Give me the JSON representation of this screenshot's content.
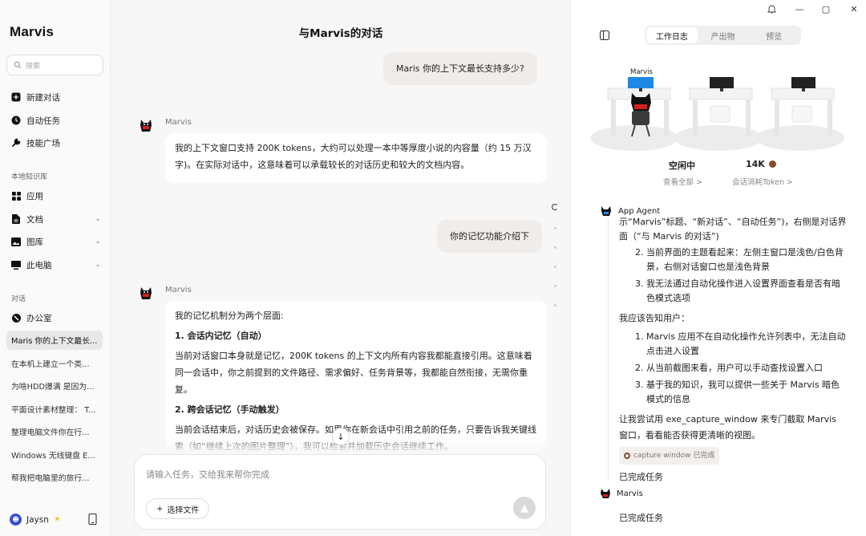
{
  "sidebar": {
    "logo": "Marvis",
    "search_placeholder": "搜索",
    "nav": [
      {
        "label": "新建对话",
        "icon": "plus-square-icon"
      },
      {
        "label": "自动任务",
        "icon": "clock-icon"
      },
      {
        "label": "技能广场",
        "icon": "wrench-icon"
      }
    ],
    "kb_label": "本地知识库",
    "kb": [
      {
        "label": "应用",
        "icon": "grid-icon"
      },
      {
        "label": "文档",
        "icon": "document-icon"
      },
      {
        "label": "图库",
        "icon": "image-icon"
      },
      {
        "label": "此电脑",
        "icon": "monitor-icon"
      }
    ],
    "conv_label": "对话",
    "office": "办公室",
    "conversations": [
      "Maris 你的上下文最长...",
      "在本机上建立一个类...",
      "为啥HDD爆满 是因为...",
      "平面设计素材整理： T...",
      "整理电脑文件你在行...",
      "Windows 无线键盘 E...",
      "帮我把电脑里的旅行..."
    ],
    "user": "Jaysn"
  },
  "chat": {
    "title": "与Marvis的对话",
    "user_msg_1": "Maris  你的上下文最长支持多少?",
    "agent_name": "Marvis",
    "agent_msg_1": "我的上下文窗口支持 200K tokens，大约可以处理一本中等厚度小说的内容量（约 15 万汉字)。在实际对话中，这意味着可以承载较长的对话历史和较大的文档内容。",
    "user_msg_2": "你的记忆功能介绍下",
    "agent_msg_2": {
      "p1": "我的记忆机制分为两个层面:",
      "h1": "1. 会话内记忆（自动）",
      "p2": "当前对话窗口本身就是记忆，200K tokens 的上下文内所有内容我都能直接引用。这意味着同一会话中，你之前提到的文件路径、需求偏好、任务背景等，我都能自然衔接，无需你重复。",
      "h2": "2. 跨会话记忆（手动触发）",
      "p3": "当前会话结束后，对话历史会被保存。如果你在新会话中引用之前的任务，只要告诉我关键线索（如“继续上次的图片整理”），我可以检索并加载历史会话继续工作。"
    },
    "composer_placeholder": "请输入任务，交给我来帮你完成",
    "file_button": "选择文件"
  },
  "panel": {
    "tabs": [
      "工作日志",
      "产出物",
      "预览"
    ],
    "active_tab": "工作日志",
    "scene_label": "Marvis",
    "status": "空闲中",
    "status_link": "查看全部 >",
    "tokens": "14K",
    "tokens_link": "会话消耗Token >",
    "log_agent": "App Agent",
    "log_text_0": "示“Marvis”标题、“新对话”、“自动任务”)，右侧是对话界面（“与 Marvis 的对话”)",
    "log_items_a": [
      "当前界面的主题看起来：左侧主窗口是浅色/白色背景，右侧对话窗口也是浅色背景",
      "我无法通过自动化操作进入设置界面查看是否有暗色模式选项"
    ],
    "log_text_1": "我应该告知用户：",
    "log_items_b": [
      "Marvis 应用不在自动化操作允许列表中，无法自动点击进入设置",
      "从当前截图来看，用户可以手动查找设置入口",
      "基于我的知识，我可以提供一些关于 Marvis 暗色模式的信息"
    ],
    "log_text_2": "让我尝试用 exe_capture_window 来专门截取 Marvis 窗口，看看能否获得更清晰的视图。",
    "tag": "capture window 已完成",
    "done_1": "已完成任务",
    "log_agent_2": "Marvis",
    "done_2": "已完成任务"
  },
  "colors": {
    "accent": "#1e88e5",
    "brand_dark": "#111111",
    "user_bubble": "#f0ece9"
  }
}
